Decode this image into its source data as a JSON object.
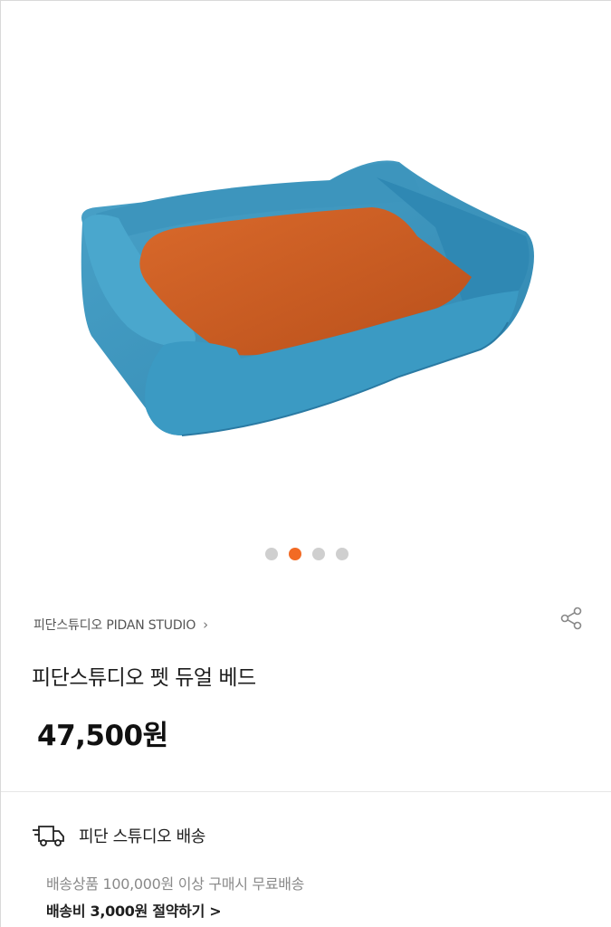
{
  "gallery": {
    "image_alt": "",
    "slide_count": 4,
    "active_slide_index": 1,
    "active_color": "#f26a24",
    "inactive_color": "#cfcfcf"
  },
  "product": {
    "brand": "피단스튜디오 PIDAN STUDIO",
    "brand_chevron": "›",
    "title": "피단스튜디오 펫 듀얼 베드",
    "price": "47,500원"
  },
  "shipping": {
    "title": "피단 스튜디오 배송",
    "condition": "배송상품 100,000원 이상 구매시 무료배송",
    "save_link": "배송비 3,000원 절약하기 >"
  },
  "icons": {
    "share": "share-icon",
    "truck": "delivery-truck-icon"
  }
}
